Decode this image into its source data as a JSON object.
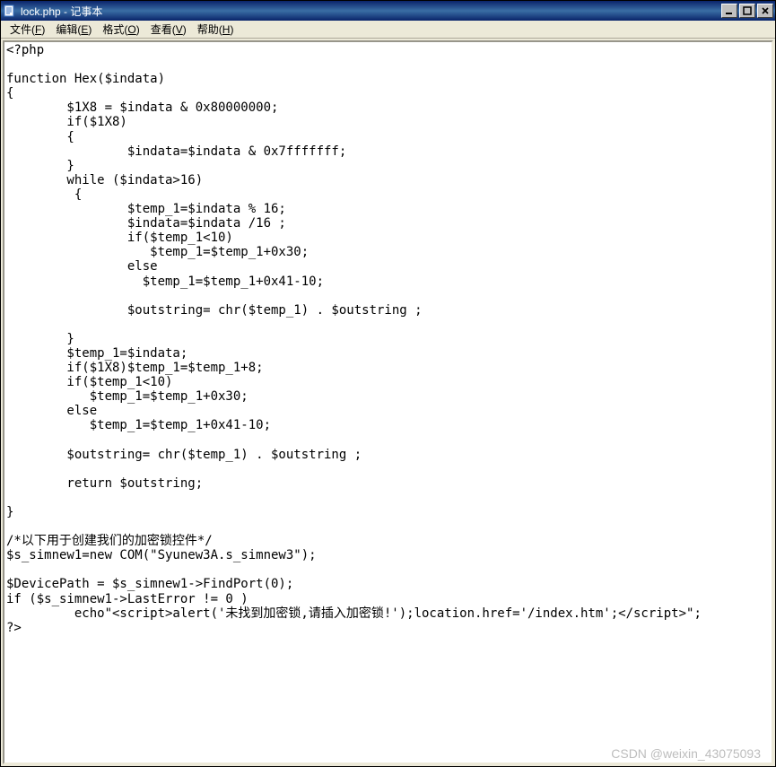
{
  "title": "lock.php - 记事本",
  "menu": {
    "file": {
      "label": "文件",
      "key": "F"
    },
    "edit": {
      "label": "编辑",
      "key": "E"
    },
    "format": {
      "label": "格式",
      "key": "O"
    },
    "view": {
      "label": "查看",
      "key": "V"
    },
    "help": {
      "label": "帮助",
      "key": "H"
    }
  },
  "content": "<?php\n\nfunction Hex($indata)\n{\n        $1X8 = $indata & 0x80000000;\n        if($1X8)\n        {\n                $indata=$indata & 0x7fffffff;\n        }\n        while ($indata>16)\n         {\n                $temp_1=$indata % 16;\n                $indata=$indata /16 ;\n                if($temp_1<10)\n                   $temp_1=$temp_1+0x30;\n                else\n                  $temp_1=$temp_1+0x41-10;\n\n                $outstring= chr($temp_1) . $outstring ;\n\n        }\n        $temp_1=$indata;\n        if($1X8)$temp_1=$temp_1+8;\n        if($temp_1<10)\n           $temp_1=$temp_1+0x30;\n        else\n           $temp_1=$temp_1+0x41-10;\n\n        $outstring= chr($temp_1) . $outstring ;\n\n        return $outstring;\n\n}\n\n/*以下用于创建我们的加密锁控件*/\n$s_simnew1=new COM(\"Syunew3A.s_simnew3\");\n\n$DevicePath = $s_simnew1->FindPort(0);\nif ($s_simnew1->LastError != 0 )\n         echo\"<script>alert('未找到加密锁,请插入加密锁!');location.href='/index.htm';</script>\";\n?>",
  "watermark": "CSDN @weixin_43075093"
}
